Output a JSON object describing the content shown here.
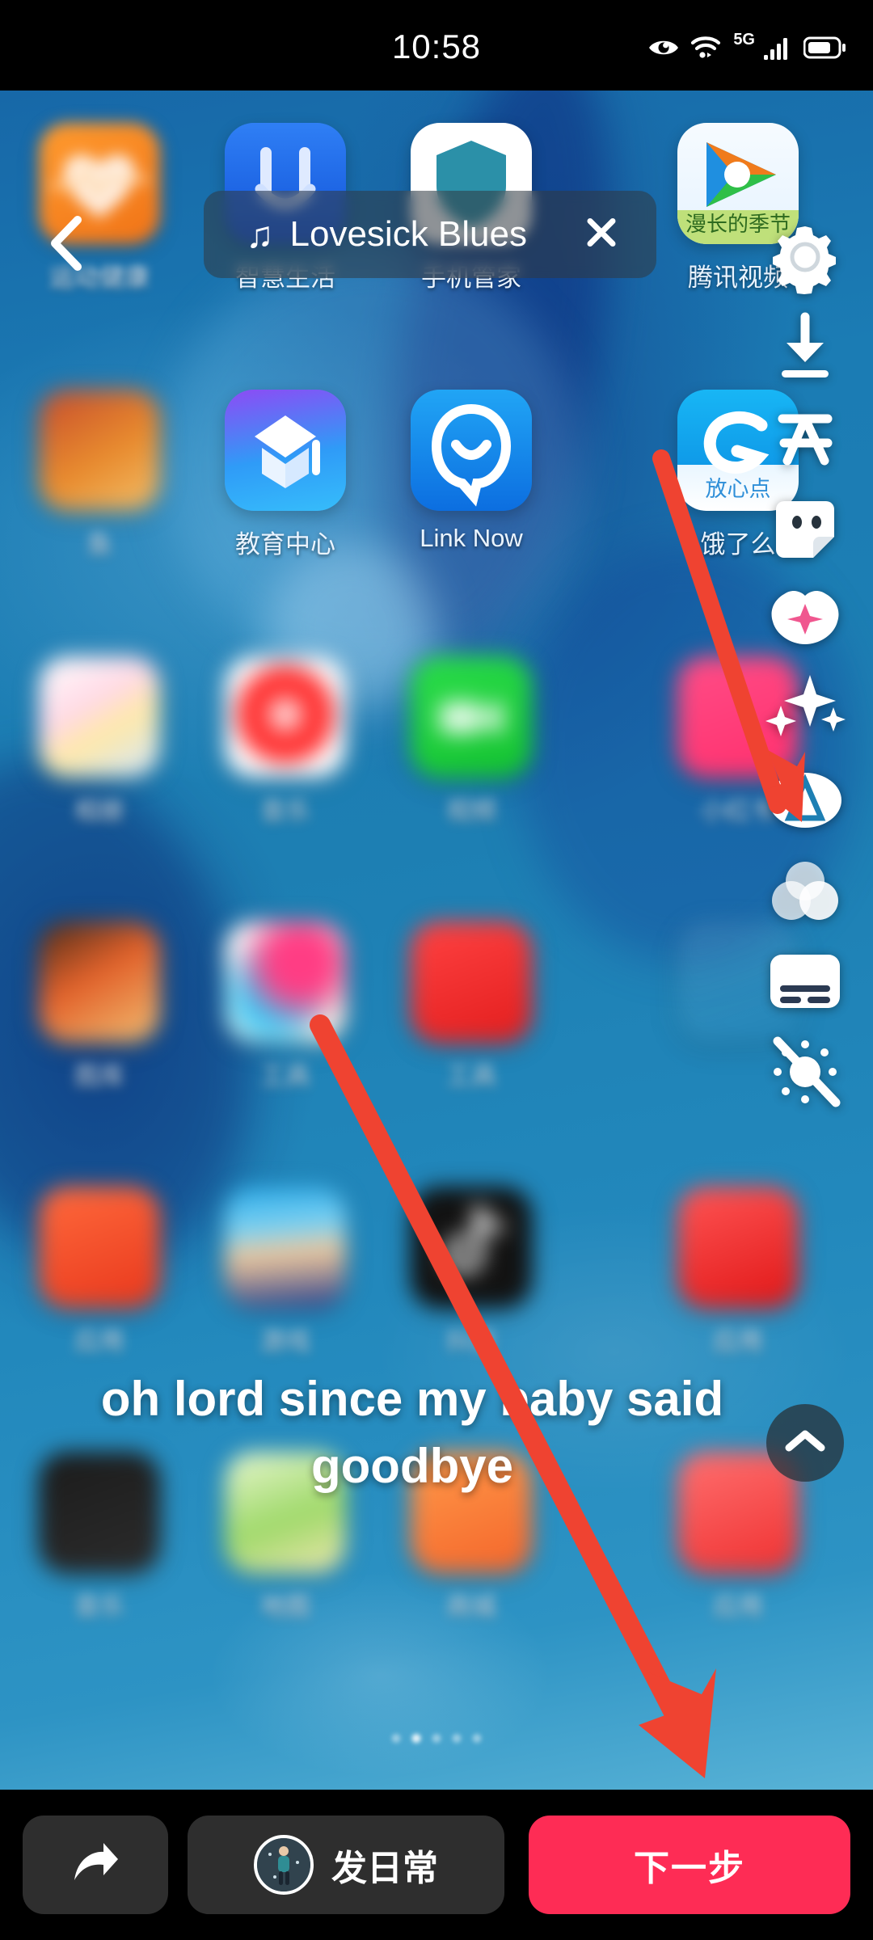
{
  "status_bar": {
    "time": "10:58",
    "icons": [
      "eye-care-icon",
      "wifi-icon",
      "5g-icon",
      "signal-bars-icon",
      "battery-icon"
    ],
    "network_label": "5G"
  },
  "music_chip": {
    "note_glyph": "♫",
    "title": "Lovesick Blues",
    "close_label": "✕"
  },
  "back_button": {
    "name": "back-chevron"
  },
  "right_toolbar": {
    "items": [
      {
        "name": "settings-gear-icon",
        "label": "设置"
      },
      {
        "name": "download-icon",
        "label": "下载"
      },
      {
        "name": "text-icon",
        "label": "文"
      },
      {
        "name": "sticker-icon",
        "label": "贴纸"
      },
      {
        "name": "beautify-icon",
        "label": "美化"
      },
      {
        "name": "effects-sparkle-icon",
        "label": "特效"
      },
      {
        "name": "filter-a-icon",
        "label": "滤镜"
      },
      {
        "name": "adjust-circles-icon",
        "label": "调节"
      },
      {
        "name": "captions-icon",
        "label": "字幕"
      },
      {
        "name": "flash-off-icon",
        "label": "关闪光"
      }
    ],
    "collapse_icon": "chevron-up-icon"
  },
  "lyric_caption": {
    "line1": "oh lord since my baby said",
    "line2": "goodbye"
  },
  "annotations": {
    "arrow_color": "#EF4331",
    "arrows": [
      {
        "name": "annotation-arrow-upper",
        "from": [
          818,
          567
        ],
        "to": [
          966,
          1000
        ]
      },
      {
        "name": "annotation-arrow-lower",
        "from": [
          396,
          1268
        ],
        "to": [
          862,
          2192
        ]
      }
    ]
  },
  "bottom_bar": {
    "share_label": "",
    "share_icon": "share-arrow-icon",
    "daily_label": "发日常",
    "daily_avatar": "walking-person-avatar",
    "next_label": "下一步",
    "next_color": "#FE2C55"
  },
  "home_screen": {
    "page_indicator": {
      "total": 5,
      "active": 2
    },
    "rows": [
      [
        {
          "name": "app-huawei-health",
          "label": "运动健康",
          "blur": "soft"
        },
        {
          "name": "app-smart-life",
          "label": "智慧生活",
          "blur": "none"
        },
        {
          "name": "app-phone-manager",
          "label": "手机管家",
          "blur": "none"
        },
        {
          "name": "app-tencent-video",
          "label": "腾讯视频",
          "blur": "none"
        }
      ],
      [
        {
          "name": "app-game",
          "label": "鱼",
          "blur": "hard"
        },
        {
          "name": "app-education",
          "label": "教育中心",
          "blur": "none"
        },
        {
          "name": "app-link-now",
          "label": "Link Now",
          "blur": "none"
        },
        {
          "name": "app-eleme",
          "label": "饿了么",
          "blur": "none"
        }
      ],
      [
        {
          "name": "app-photos",
          "label": "相册",
          "blur": "hard"
        },
        {
          "name": "app-music",
          "label": "音乐",
          "blur": "hard"
        },
        {
          "name": "app-wechat-video",
          "label": "视频",
          "blur": "hard"
        },
        {
          "name": "app-pink",
          "label": "小红书",
          "blur": "hard"
        }
      ],
      [
        {
          "name": "app-gallery-dark",
          "label": "图库",
          "blur": "hard"
        },
        {
          "name": "app-gradient",
          "label": "工具",
          "blur": "hard"
        },
        {
          "name": "app-red-tool",
          "label": "工具",
          "blur": "hard"
        },
        {
          "name": "app-empty-1",
          "label": "",
          "blur": "hard"
        }
      ],
      [
        {
          "name": "app-orange-red",
          "label": "应用",
          "blur": "hard"
        },
        {
          "name": "app-character",
          "label": "游戏",
          "blur": "hard"
        },
        {
          "name": "app-douyin",
          "label": "抖音",
          "blur": "hard"
        },
        {
          "name": "app-red-heart",
          "label": "应用",
          "blur": "hard"
        }
      ],
      [
        {
          "name": "app-dark-music",
          "label": "音乐",
          "blur": "hard"
        },
        {
          "name": "app-green-map",
          "label": "地图",
          "blur": "hard"
        },
        {
          "name": "app-orange-shop",
          "label": "商城",
          "blur": "hard"
        },
        {
          "name": "app-red-app",
          "label": "应用",
          "blur": "hard"
        }
      ]
    ]
  }
}
